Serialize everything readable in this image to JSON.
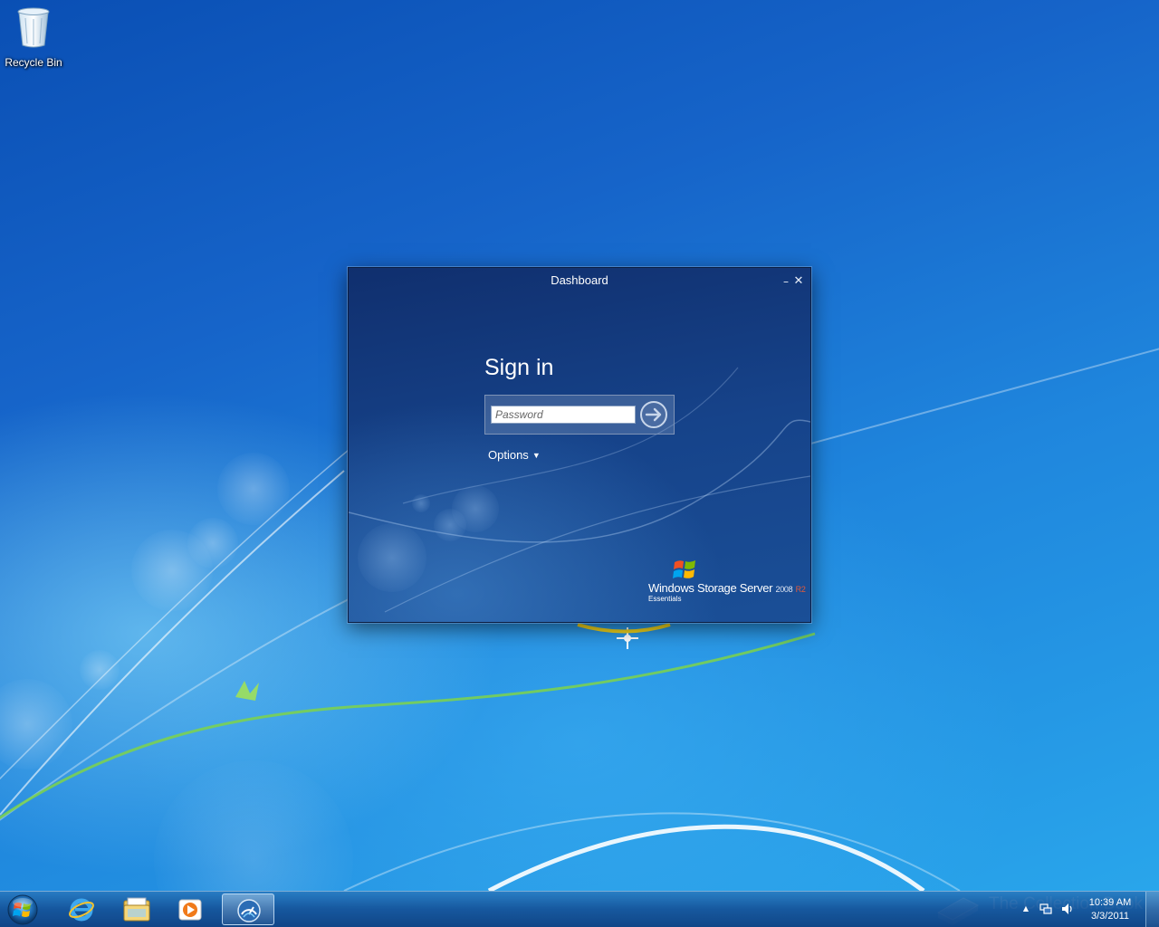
{
  "desktop": {
    "icons": [
      {
        "label": "Recycle Bin",
        "icon": "recycle-bin-icon"
      }
    ]
  },
  "dialog": {
    "title": "Dashboard",
    "minimize_symbol": "–",
    "close_symbol": "✕",
    "heading": "Sign in",
    "password_placeholder": "Password",
    "submit_icon": "arrow-right-circle-icon",
    "options_label": "Options",
    "options_caret": "▼",
    "brand": {
      "product": "Windows Storage Server",
      "version": "2008",
      "release": "R2",
      "edition": "Essentials",
      "logo": "windows-flag-icon"
    }
  },
  "taskbar": {
    "start_icon": "windows-orb-icon",
    "pinned": [
      {
        "name": "internet-explorer",
        "icon": "internet-explorer-icon",
        "active": false
      },
      {
        "name": "windows-explorer",
        "icon": "folder-icon",
        "active": false
      },
      {
        "name": "media-player",
        "icon": "media-player-icon",
        "active": false
      },
      {
        "name": "dashboard",
        "icon": "dashboard-icon",
        "active": true
      }
    ],
    "tray": {
      "show_hidden": "▲",
      "time": "10:39 AM",
      "date": "3/3/2011"
    }
  },
  "watermark": {
    "text": "The Collection Book"
  },
  "colors": {
    "desktop_blue": "#1664c9",
    "dialog_blue": "#16438a",
    "release_red": "#e45a3a"
  }
}
